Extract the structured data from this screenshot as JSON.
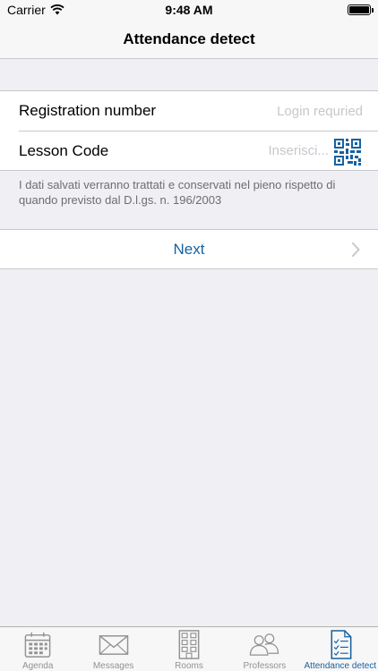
{
  "status_bar": {
    "carrier": "Carrier",
    "time": "9:48 AM"
  },
  "nav": {
    "title": "Attendance detect"
  },
  "form": {
    "registration": {
      "label": "Registration number",
      "placeholder": "Login requried"
    },
    "lesson": {
      "label": "Lesson Code",
      "placeholder": "Inserisci..."
    }
  },
  "footnote": "I dati salvati verranno trattati e conservati nel pieno rispetto di quando previsto dal D.l.gs. n. 196/2003",
  "next": {
    "label": "Next"
  },
  "tabs": [
    {
      "label": "Agenda",
      "icon": "calendar-icon"
    },
    {
      "label": "Messages",
      "icon": "envelope-icon"
    },
    {
      "label": "Rooms",
      "icon": "building-icon"
    },
    {
      "label": "Professors",
      "icon": "people-icon"
    },
    {
      "label": "Attendance detect",
      "icon": "checklist-icon"
    }
  ],
  "colors": {
    "accent": "#17619f",
    "inactive": "#929292",
    "placeholder": "#c7c7cd",
    "background": "#efeff4"
  }
}
